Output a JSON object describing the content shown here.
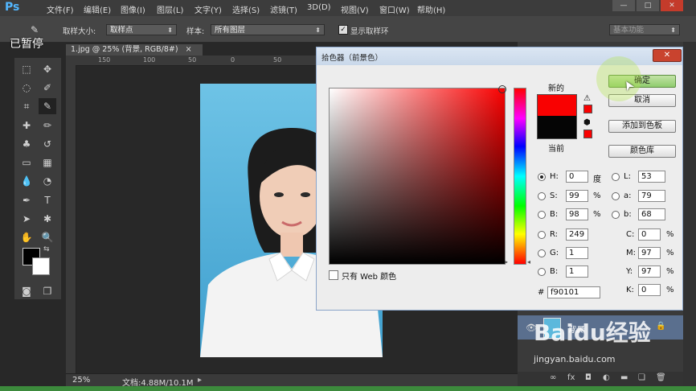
{
  "app": {
    "logo": "Ps",
    "paused_label": "已暂停",
    "menus": [
      "文件(F)",
      "编辑(E)",
      "图像(I)",
      "图层(L)",
      "文字(Y)",
      "选择(S)",
      "滤镜(T)",
      "3D(D)",
      "视图(V)",
      "窗口(W)",
      "帮助(H)"
    ],
    "window_controls": [
      "—",
      "□",
      "✕"
    ]
  },
  "options_bar": {
    "sample_size_label": "取样大小:",
    "sample_size_value": "取样点",
    "sample_label": "样本:",
    "sample_value": "所有图层",
    "show_ring_label": "显示取样环",
    "workspace_value": "基本功能"
  },
  "document": {
    "tab_title": "1.jpg @ 25% (背景, RGB/8#)",
    "tab_close": "×",
    "ruler_top_numbers": [
      "150",
      "100",
      "50",
      "0",
      "50"
    ],
    "zoom": "25%",
    "doc_info": "文档:4.88M/10.1M"
  },
  "color_picker": {
    "title": "拾色器（前景色）",
    "new_label": "新的",
    "current_label": "当前",
    "ok_label": "确定",
    "cancel_label": "取消",
    "add_swatch_label": "添加到色板",
    "color_library_label": "颜色库",
    "web_only_label": "只有 Web 颜色",
    "new_color": "#f90101",
    "current_color": "#050505",
    "hsb": [
      {
        "label": "H:",
        "value": "0",
        "unit": "度"
      },
      {
        "label": "S:",
        "value": "99",
        "unit": "%"
      },
      {
        "label": "B:",
        "value": "98",
        "unit": "%"
      }
    ],
    "rgb": [
      {
        "label": "R:",
        "value": "249"
      },
      {
        "label": "G:",
        "value": "1"
      },
      {
        "label": "B:",
        "value": "1"
      }
    ],
    "lab": [
      {
        "label": "L:",
        "value": "53"
      },
      {
        "label": "a:",
        "value": "79"
      },
      {
        "label": "b:",
        "value": "68"
      }
    ],
    "cmyk": [
      {
        "label": "C:",
        "value": "0",
        "unit": "%"
      },
      {
        "label": "M:",
        "value": "97",
        "unit": "%"
      },
      {
        "label": "Y:",
        "value": "97",
        "unit": "%"
      },
      {
        "label": "K:",
        "value": "0",
        "unit": "%"
      }
    ],
    "hex_label": "#",
    "hex_value": "f90101"
  },
  "layers": {
    "layer_name": "背景"
  },
  "watermark": {
    "brand": "Baidu经验",
    "url": "jingyan.baidu.com"
  }
}
